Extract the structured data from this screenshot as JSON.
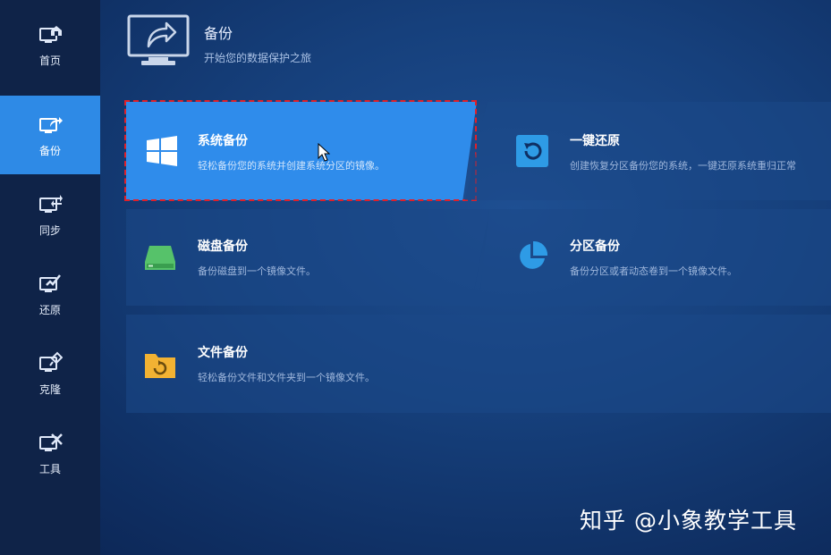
{
  "sidebar": {
    "items": [
      {
        "label": "首页",
        "icon": "home-icon"
      },
      {
        "label": "备份",
        "icon": "backup-icon",
        "active": true
      },
      {
        "label": "同步",
        "icon": "sync-icon"
      },
      {
        "label": "还原",
        "icon": "restore-icon"
      },
      {
        "label": "克隆",
        "icon": "clone-icon"
      },
      {
        "label": "工具",
        "icon": "tools-icon"
      }
    ],
    "active_color": "#2e8ae6",
    "background": "#0f2348"
  },
  "header": {
    "title": "备份",
    "subtitle": "开始您的数据保护之旅",
    "icon": "monitor-share-icon"
  },
  "cards": {
    "system": {
      "title": "系统备份",
      "desc": "轻松备份您的系统并创建系统分区的镜像。",
      "icon": "windows-icon",
      "selected": true
    },
    "restore": {
      "title": "一键还原",
      "desc": "创建恢复分区备份您的系统，一键还原系统重归正常",
      "icon": "one-click-restore-icon"
    },
    "disk": {
      "title": "磁盘备份",
      "desc": "备份磁盘到一个镜像文件。",
      "icon": "disk-drive-icon"
    },
    "partition": {
      "title": "分区备份",
      "desc": "备份分区或者动态卷到一个镜像文件。",
      "icon": "pie-chart-icon"
    },
    "file": {
      "title": "文件备份",
      "desc": "轻松备份文件和文件夹到一个镜像文件。",
      "icon": "folder-sync-icon"
    }
  },
  "colors": {
    "selected_card": "#2f8ceb",
    "selection_outline": "#e0202a",
    "disk_icon": "#56c26a",
    "folder_icon": "#f2b233",
    "restore_icon": "#2e9be6"
  },
  "watermark": "知乎 @小象教学工具"
}
